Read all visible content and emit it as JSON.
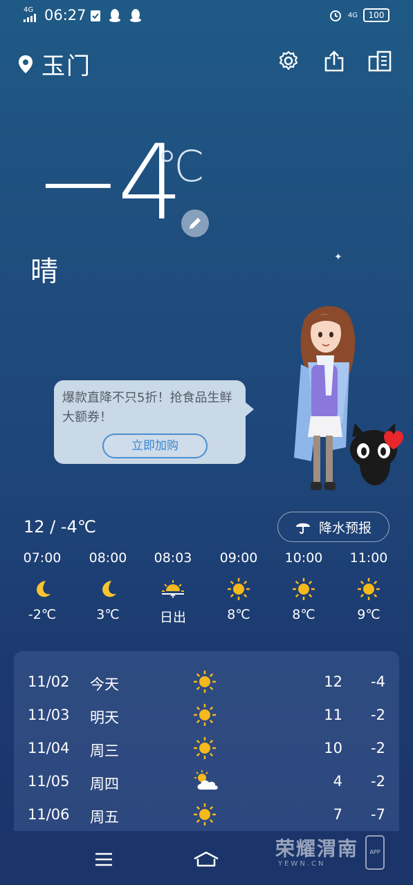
{
  "status_bar": {
    "network": "4G",
    "time": "06:27",
    "network_right": "4G",
    "battery": "100",
    "icons": [
      "signal-icon",
      "check-clipboard-icon",
      "qq-icon",
      "qq-icon",
      "alarm-icon"
    ]
  },
  "header": {
    "city": "玉门",
    "actions": [
      "settings-icon",
      "share-icon",
      "city-list-icon"
    ]
  },
  "current": {
    "temperature": "−4",
    "unit": "℃",
    "condition": "晴"
  },
  "ad": {
    "text": "爆款直降不只5折！抢食品生鲜大额券！",
    "button": "立即加购"
  },
  "today": {
    "range": "12 / -4℃",
    "precip_button": "降水预报"
  },
  "hourly": [
    {
      "time": "07:00",
      "icon": "moon-icon",
      "value": "-2℃"
    },
    {
      "time": "08:00",
      "icon": "moon-icon",
      "value": "3℃"
    },
    {
      "time": "08:03",
      "icon": "sunrise-icon",
      "value": "日出"
    },
    {
      "time": "09:00",
      "icon": "sun-icon",
      "value": "8℃"
    },
    {
      "time": "10:00",
      "icon": "sun-icon",
      "value": "8℃"
    },
    {
      "time": "11:00",
      "icon": "sun-icon",
      "value": "9℃"
    }
  ],
  "daily": [
    {
      "date": "11/02",
      "weekday": "今天",
      "icon": "sun-icon",
      "high": "12",
      "low": "-4"
    },
    {
      "date": "11/03",
      "weekday": "明天",
      "icon": "sun-icon",
      "high": "11",
      "low": "-2"
    },
    {
      "date": "11/04",
      "weekday": "周三",
      "icon": "sun-icon",
      "high": "10",
      "low": "-2"
    },
    {
      "date": "11/05",
      "weekday": "周四",
      "icon": "partly-cloudy-icon",
      "high": "4",
      "low": "-2"
    },
    {
      "date": "11/06",
      "weekday": "周五",
      "icon": "sun-icon",
      "high": "7",
      "low": "-7"
    }
  ],
  "watermark": {
    "title": "荣耀渭南",
    "site": "YEWN.CN",
    "badge": "APP"
  },
  "colors": {
    "sun": "#f5b81d",
    "moon": "#f7c531",
    "ad_button": "#3a86d0"
  }
}
